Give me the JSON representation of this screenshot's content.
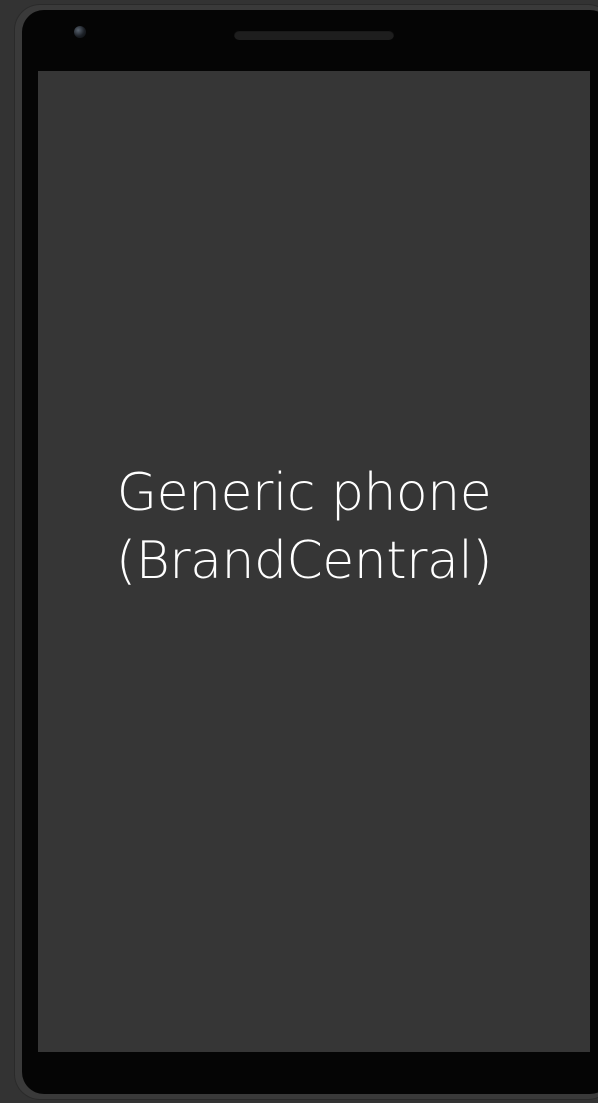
{
  "device": {
    "name_line1": "Generic phone",
    "name_line2": "(BrandCentral)"
  },
  "colors": {
    "background": "#333333",
    "bezel": "#050505",
    "screen": "#363636",
    "label_text": "#ffffff"
  },
  "icons": {
    "camera": "front-camera-icon",
    "speaker": "earpiece-speaker"
  }
}
